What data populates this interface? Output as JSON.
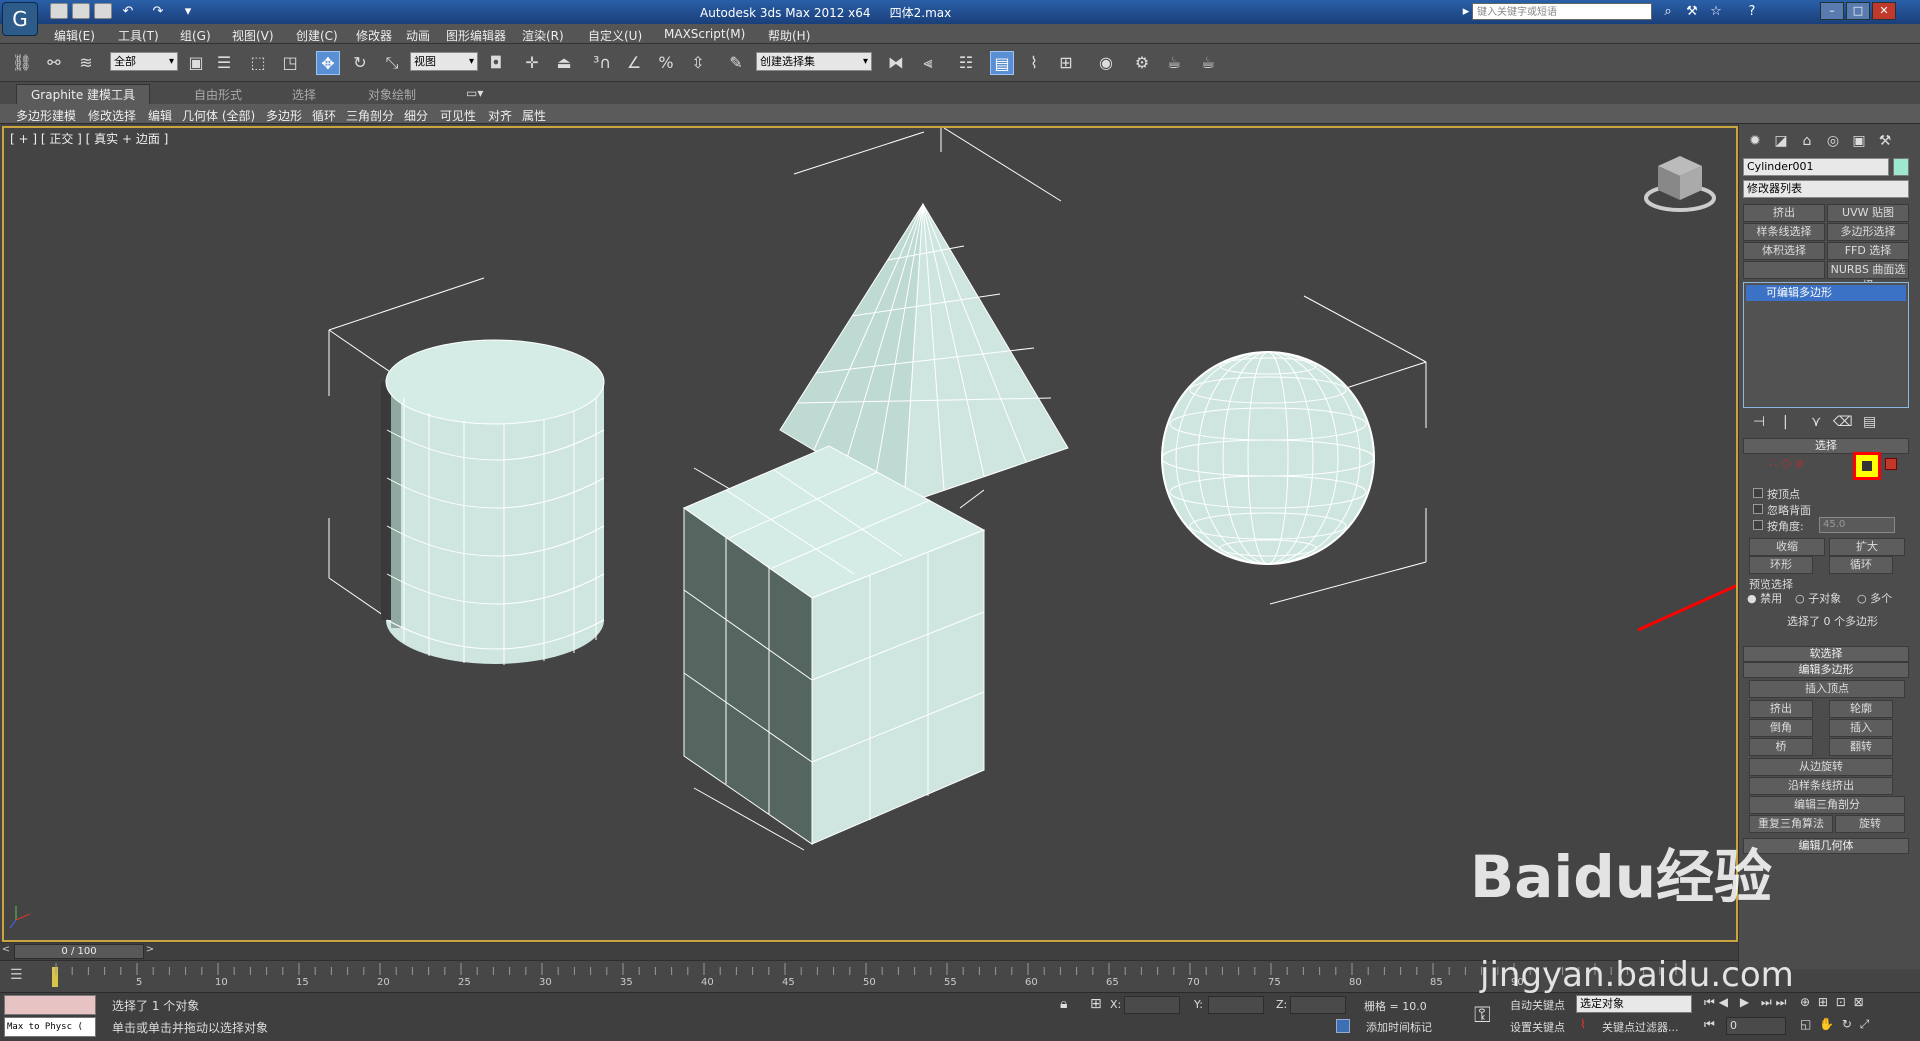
{
  "title": {
    "app_title": "Autodesk 3ds Max  2012 x64",
    "file_name": "四体2.max",
    "help_search_placeholder": "键入关键字或短语"
  },
  "menu": [
    "编辑(E)",
    "工具(T)",
    "组(G)",
    "视图(V)",
    "创建(C)",
    "修改器",
    "动画",
    "图形编辑器",
    "渲染(R)",
    "自定义(U)",
    "MAXScript(M)",
    "帮助(H)"
  ],
  "toolbar": {
    "selection_filter": "全部",
    "reference_coord": "视图",
    "named_selection": "创建选择集"
  },
  "ribbon": {
    "tabs": [
      "Graphite 建模工具",
      "自由形式",
      "选择",
      "对象绘制"
    ],
    "panel_items": [
      "多边形建模",
      "修改选择",
      "编辑",
      "几何体 (全部)",
      "多边形",
      "循环",
      "三角剖分",
      "细分",
      "可见性",
      "对齐",
      "属性"
    ]
  },
  "viewport": {
    "label": "[ + ] [ 正交 ] [ 真实 + 边面 ]"
  },
  "command_panel": {
    "object_name": "Cylinder001",
    "modifier_list": "修改器列表",
    "modifier_buttons": [
      "挤出",
      "UVW 贴图",
      "样条线选择",
      "多边形选择",
      "体积选择",
      "FFD 选择",
      "",
      "NURBS 曲面选择"
    ],
    "stack_item": "可编辑多边形",
    "selection_rollout": "选择",
    "by_vertex": "按顶点",
    "ignore_backfacing": "忽略背面",
    "by_angle": "按角度:",
    "by_angle_value": "45.0",
    "shrink": "收缩",
    "grow": "扩大",
    "ring": "环形",
    "loop": "循环",
    "preview_selection": "预览选择",
    "preview_options": [
      "禁用",
      "子对象",
      "多个"
    ],
    "selection_info": "选择了 0 个多边形",
    "soft_selection": "软选择",
    "edit_polygons": "编辑多边形",
    "insert_vertex": "插入顶点",
    "ops": [
      "挤出",
      "轮廓",
      "倒角",
      "插入",
      "桥",
      "翻转"
    ],
    "hinge_from_edge": "从边旋转",
    "extrude_along_spline": "沿样条线挤出",
    "edit_triangulation": "编辑三角剖分",
    "retriangulate": "重复三角算法",
    "turn": "旋转",
    "edit_geometry": "编辑几何体"
  },
  "timeline": {
    "frame_display": "0 / 100",
    "ticks": [
      "5",
      "10",
      "15",
      "20",
      "25",
      "30",
      "35",
      "40",
      "45",
      "50",
      "55",
      "60",
      "65",
      "70",
      "75",
      "80",
      "85",
      "90"
    ]
  },
  "status": {
    "script_listener": "Max to Physc (",
    "selected_info": "选择了 1 个对象",
    "prompt": "单击或单击并拖动以选择对象",
    "x_label": "X:",
    "y_label": "Y:",
    "z_label": "Z:",
    "grid": "栅格 = 10.0",
    "add_time_tag": "添加时间标记",
    "auto_key": "自动关键点",
    "set_key": "设置关键点",
    "key_mode": "选定对象",
    "key_filters": "关键点过滤器...",
    "current_frame": "0"
  },
  "watermark": {
    "main": "Baidu经验",
    "sub": "jingyan.baidu.com"
  },
  "colors": {
    "viewport_bg": "#444444",
    "object_fill": "#cfe6e0",
    "wireframe": "#ffffff",
    "highlight_red": "#ff0000",
    "viewport_border": "#c9a43f"
  }
}
